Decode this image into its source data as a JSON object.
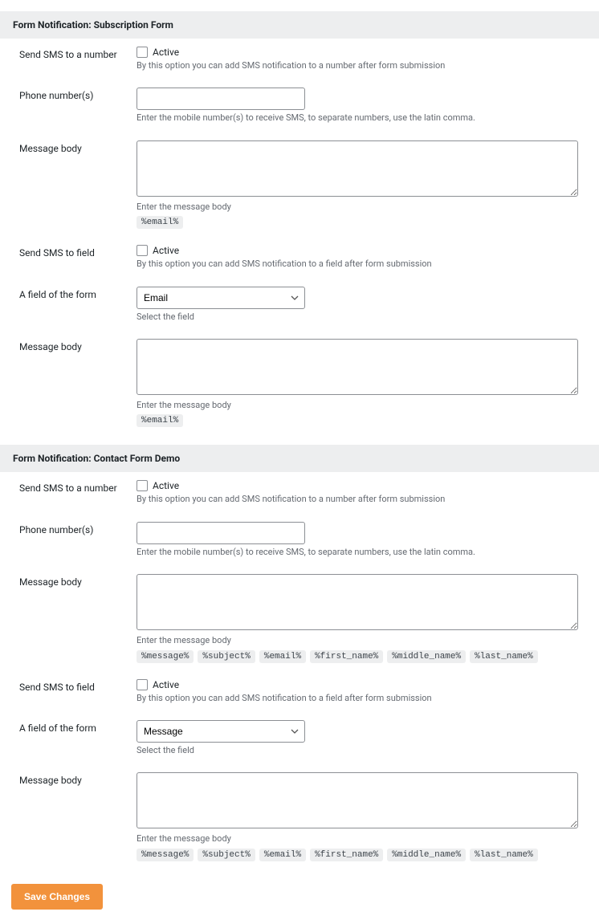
{
  "sections": [
    {
      "title": "Form Notification: Subscription Form",
      "sms_number": {
        "label": "Send SMS to a number",
        "active_label": "Active",
        "help": "By this option you can add SMS notification to a number after form submission"
      },
      "phone": {
        "label": "Phone number(s)",
        "help": "Enter the mobile number(s) to receive SMS, to separate numbers, use the latin comma.",
        "value": ""
      },
      "msg1": {
        "label": "Message body",
        "help": "Enter the message body",
        "tags": [
          "%email%"
        ],
        "value": ""
      },
      "sms_field": {
        "label": "Send SMS to field",
        "active_label": "Active",
        "help": "By this option you can add SMS notification to a field after form submission"
      },
      "field": {
        "label": "A field of the form",
        "selected": "Email",
        "help": "Select the field"
      },
      "msg2": {
        "label": "Message body",
        "help": "Enter the message body",
        "tags": [
          "%email%"
        ],
        "value": ""
      }
    },
    {
      "title": "Form Notification: Contact Form Demo",
      "sms_number": {
        "label": "Send SMS to a number",
        "active_label": "Active",
        "help": "By this option you can add SMS notification to a number after form submission"
      },
      "phone": {
        "label": "Phone number(s)",
        "help": "Enter the mobile number(s) to receive SMS, to separate numbers, use the latin comma.",
        "value": ""
      },
      "msg1": {
        "label": "Message body",
        "help": "Enter the message body",
        "tags": [
          "%message%",
          "%subject%",
          "%email%",
          "%first_name%",
          "%middle_name%",
          "%last_name%"
        ],
        "value": ""
      },
      "sms_field": {
        "label": "Send SMS to field",
        "active_label": "Active",
        "help": "By this option you can add SMS notification to a field after form submission"
      },
      "field": {
        "label": "A field of the form",
        "selected": "Message",
        "help": "Select the field"
      },
      "msg2": {
        "label": "Message body",
        "help": "Enter the message body",
        "tags": [
          "%message%",
          "%subject%",
          "%email%",
          "%first_name%",
          "%middle_name%",
          "%last_name%"
        ],
        "value": ""
      }
    }
  ],
  "save_label": "Save Changes"
}
